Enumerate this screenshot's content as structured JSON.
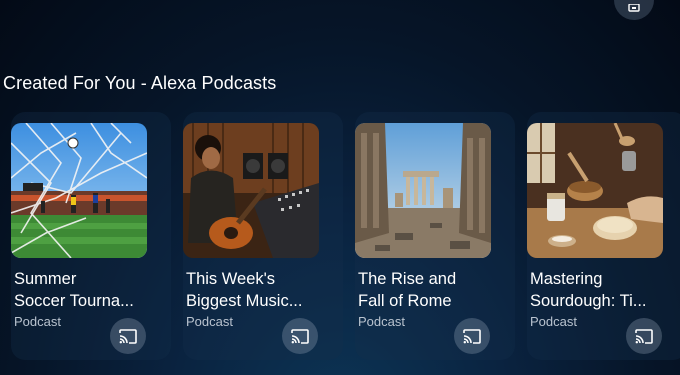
{
  "section": {
    "title": "Created For You - Alexa Podcasts"
  },
  "cards": [
    {
      "title_line1": "Summer",
      "title_line2": "Soccer Tourna...",
      "subtitle": "Podcast",
      "image": "soccer-goal-net-image"
    },
    {
      "title_line1": "This Week's",
      "title_line2": "Biggest Music...",
      "subtitle": "Podcast",
      "image": "guitarist-studio-image"
    },
    {
      "title_line1": "The Rise and",
      "title_line2": "Fall of Rome",
      "subtitle": "Podcast",
      "image": "roman-ruins-image"
    },
    {
      "title_line1": "Mastering",
      "title_line2": "Sourdough: Ti...",
      "subtitle": "Podcast",
      "image": "baking-kitchen-image"
    }
  ],
  "icons": {
    "cast": "cast-icon",
    "top": "device-icon"
  }
}
